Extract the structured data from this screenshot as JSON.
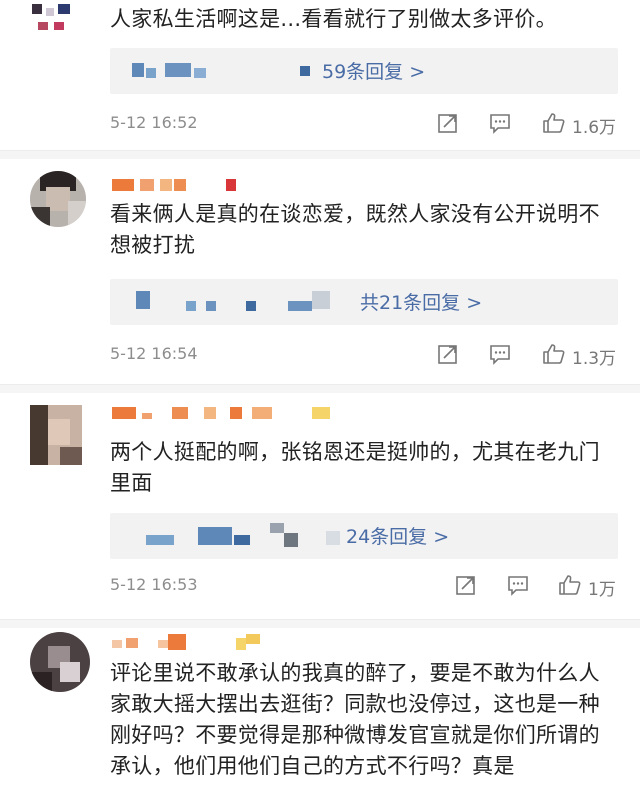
{
  "comments": [
    {
      "text": "人家私生活啊这是...看看就行了别做太多评价。",
      "reply_link": "59条回复 >",
      "time": "5-12 16:52",
      "likes": "1.6万"
    },
    {
      "text": "看来俩人是真的在谈恋爱，既然人家没有公开说明不想被打扰",
      "reply_link": "共21条回复 >",
      "time": "5-12 16:54",
      "likes": "1.3万"
    },
    {
      "text": "两个人挺配的啊，张铭恩还是挺帅的，尤其在老九门里面",
      "reply_link": "24条回复 >",
      "time": "5-12 16:53",
      "likes": "1万"
    },
    {
      "text": "评论里说不敢承认的我真的醉了，要是不敢为什么人家敢大摇大摆出去逛街？同款也没停过，这也是一种刚好吗？不要觉得是那种微博发官宣就是你们所谓的承认，他们用他们自己的方式不行吗？真是"
    }
  ],
  "icons": {
    "share": "share-icon",
    "comment": "comment-icon",
    "like": "thumbs-up-icon"
  },
  "colors": {
    "reply_link": "#4a6ca6",
    "reply_box_bg": "#f2f2f2",
    "timestamp": "#8d8d8d"
  }
}
